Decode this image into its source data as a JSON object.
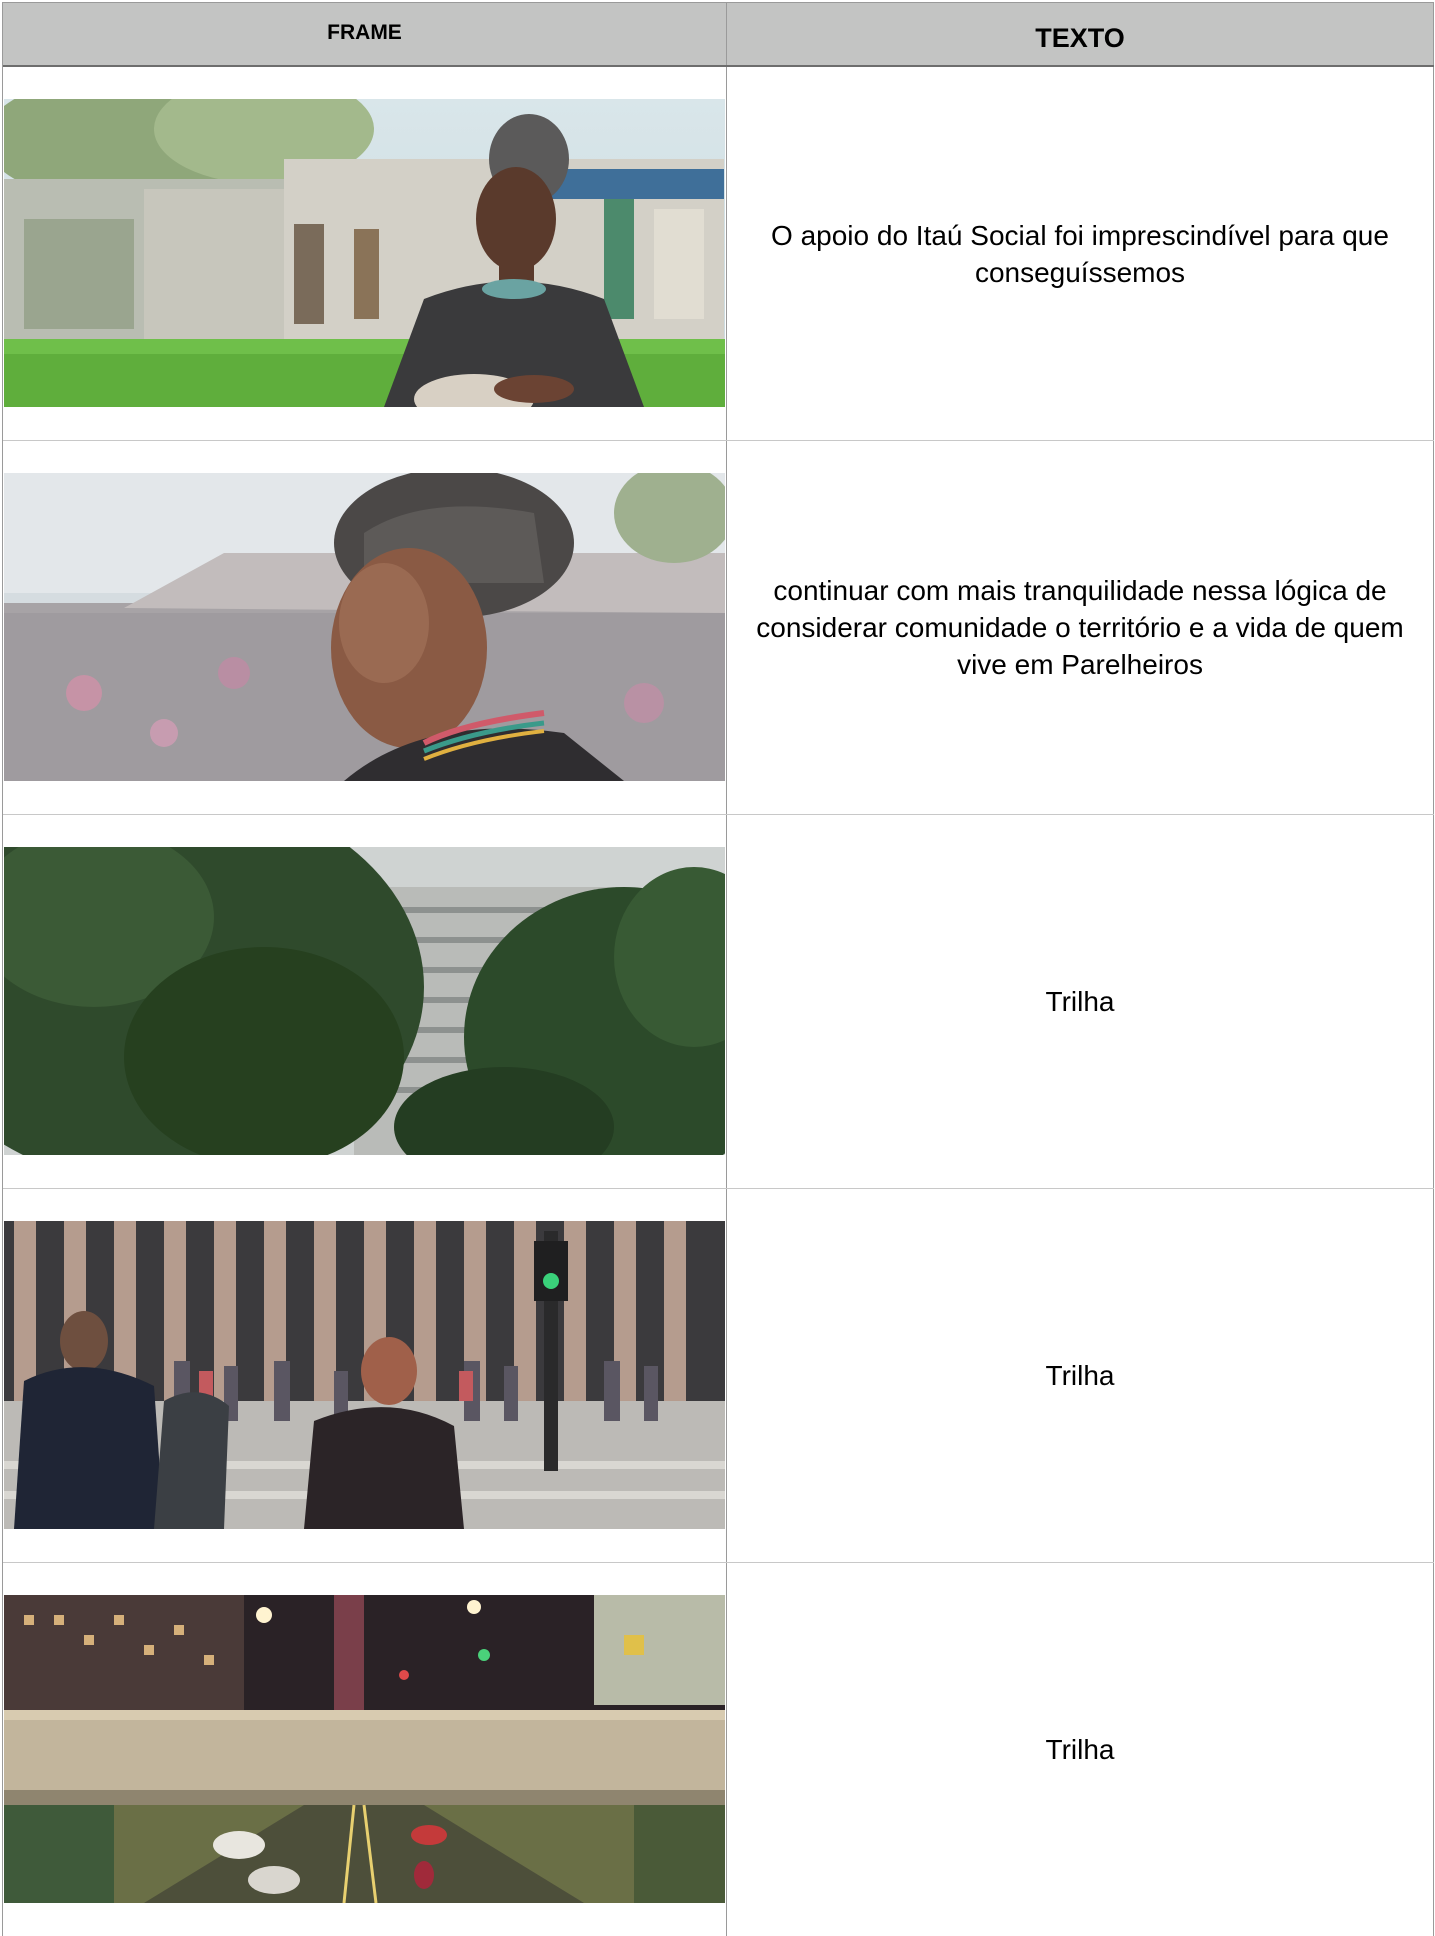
{
  "header": {
    "frame": "FRAME",
    "text": "TEXTO"
  },
  "rows": [
    {
      "frame_icon": "woman-seated-outdoors-photo",
      "text": "O apoio do Itaú Social foi imprescindível para que conseguíssemos"
    },
    {
      "frame_icon": "woman-profile-closeup-photo",
      "text": "continuar com mais tranquilidade nessa lógica de considerar comunidade o território e a vida de quem vive em Parelheiros"
    },
    {
      "frame_icon": "trees-and-building-photo",
      "text": "Trilha"
    },
    {
      "frame_icon": "pedestrians-crosswalk-photo",
      "text": "Trilha"
    },
    {
      "frame_icon": "night-overpass-traffic-photo",
      "text": "Trilha"
    }
  ]
}
